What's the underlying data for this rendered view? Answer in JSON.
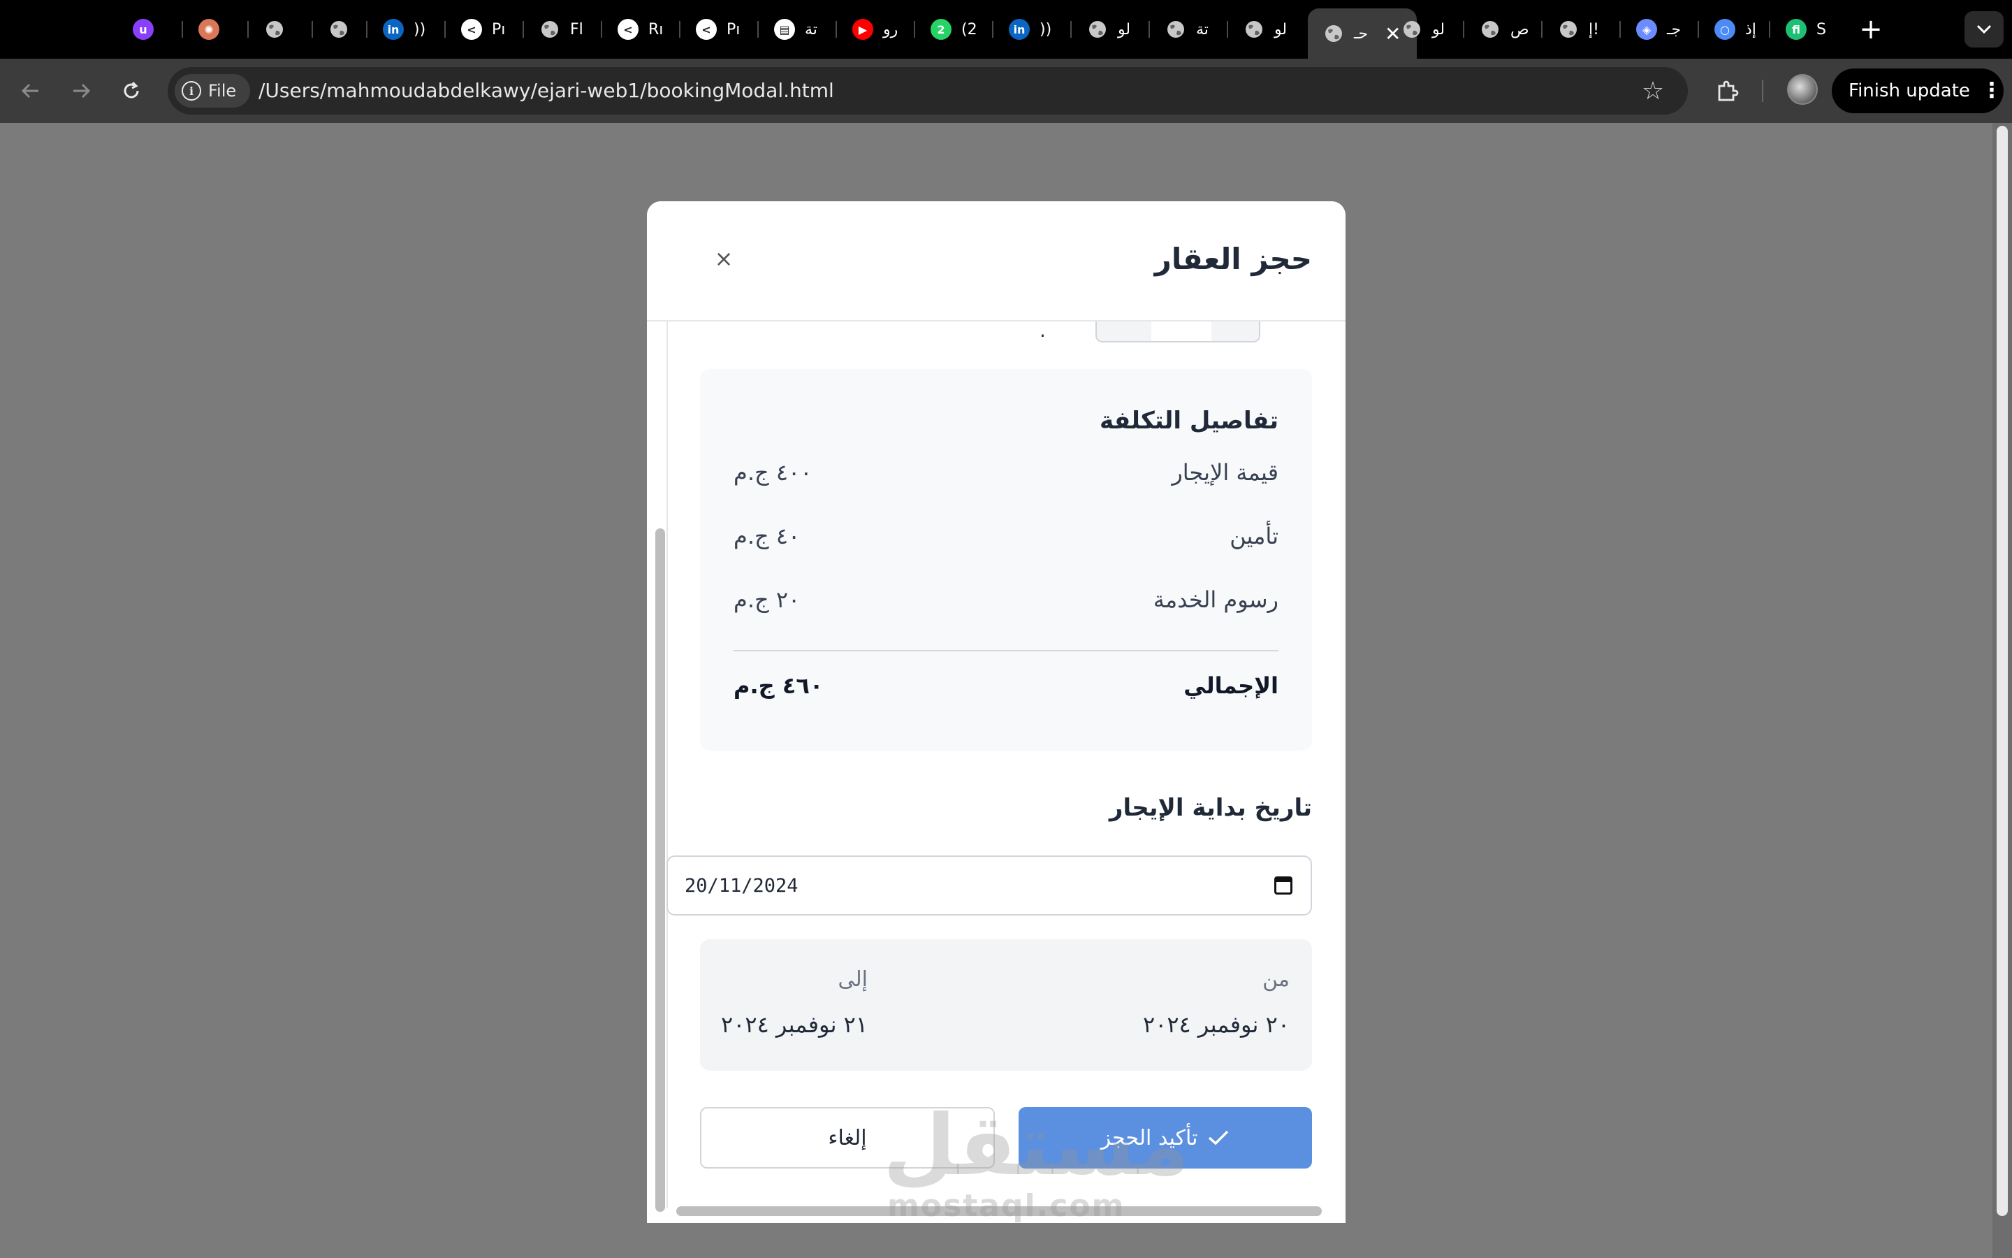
{
  "tabs": [
    {
      "label": "",
      "icon": "unstop-icon",
      "color": "#8a3ffc",
      "glyph": "u"
    },
    {
      "label": "",
      "icon": "claude-icon",
      "color": "#d97757",
      "glyph": "✺"
    },
    {
      "label": "",
      "icon": "globe-icon",
      "color": "#9aa0a6",
      "glyph": ""
    },
    {
      "label": "",
      "icon": "globe-icon",
      "color": "#9aa0a6",
      "glyph": ""
    },
    {
      "label": "))",
      "icon": "linkedin-icon",
      "color": "#0a66c2",
      "glyph": "in"
    },
    {
      "label": "Pı",
      "icon": "cursor-icon",
      "color": "#ffffff",
      "glyph": "<"
    },
    {
      "label": "Fl",
      "icon": "globe-icon",
      "color": "#9aa0a6",
      "glyph": ""
    },
    {
      "label": "Rı",
      "icon": "cursor-icon",
      "color": "#ffffff",
      "glyph": "<"
    },
    {
      "label": "Pı",
      "icon": "cursor-icon",
      "color": "#ffffff",
      "glyph": "<"
    },
    {
      "label": "تة",
      "icon": "document-icon",
      "color": "#ffffff",
      "glyph": "▤"
    },
    {
      "label": "رو",
      "icon": "youtube-icon",
      "color": "#ff0000",
      "glyph": "▶"
    },
    {
      "label": "(2",
      "icon": "whatsapp-icon",
      "color": "#25d366",
      "glyph": "2"
    },
    {
      "label": "))",
      "icon": "linkedin-icon",
      "color": "#0a66c2",
      "glyph": "in"
    },
    {
      "label": "لو",
      "icon": "globe-icon",
      "color": "#9aa0a6",
      "glyph": ""
    },
    {
      "label": "تة",
      "icon": "globe-icon",
      "color": "#9aa0a6",
      "glyph": ""
    },
    {
      "label": "لو",
      "icon": "globe-icon",
      "color": "#9aa0a6",
      "glyph": ""
    },
    {
      "label": "حـ",
      "icon": "globe-icon",
      "color": "#9aa0a6",
      "glyph": "",
      "active": true
    },
    {
      "label": "لو",
      "icon": "globe-icon",
      "color": "#9aa0a6",
      "glyph": ""
    },
    {
      "label": "ص",
      "icon": "globe-icon",
      "color": "#9aa0a6",
      "glyph": ""
    },
    {
      "label": "إ!",
      "icon": "globe-icon",
      "color": "#9aa0a6",
      "glyph": ""
    },
    {
      "label": "جـ",
      "icon": "gemini-icon",
      "color": "#6b8cff",
      "glyph": "◈"
    },
    {
      "label": "إذ",
      "icon": "circle-icon",
      "color": "#4c8bf5",
      "glyph": "○"
    },
    {
      "label": "S",
      "icon": "fiverr-icon",
      "color": "#1dbf73",
      "glyph": "fi"
    }
  ],
  "toolbar": {
    "chip_label": "File",
    "url": "/Users/mahmoudabdelkawy/ejari-web1/bookingModal.html",
    "update_label": "Finish update"
  },
  "modal": {
    "title": "حجز العقار",
    "close_symbol": "×",
    "cost": {
      "title": "تفاصيل التكلفة",
      "rows": [
        {
          "label": "قيمة الإيجار",
          "value": "٤٠٠ ج.م"
        },
        {
          "label": "تأمين",
          "value": "٤٠ ج.م"
        },
        {
          "label": "رسوم الخدمة",
          "value": "٢٠ ج.م"
        }
      ],
      "total_label": "الإجمالي",
      "total_value": "٤٦٠ ج.م"
    },
    "start_date": {
      "label": "تاريخ بداية الإيجار",
      "value": "20/11/2024"
    },
    "range": {
      "from_label": "من",
      "from_value": "٢٠ نوفمبر ٢٠٢٤",
      "to_label": "إلى",
      "to_value": "٢١ نوفمبر ٢٠٢٤"
    },
    "confirm_label": "تأكيد الحجز",
    "cancel_label": "إلغاء"
  },
  "watermark": {
    "text": "مستقل",
    "sub": "mostaql.com"
  }
}
